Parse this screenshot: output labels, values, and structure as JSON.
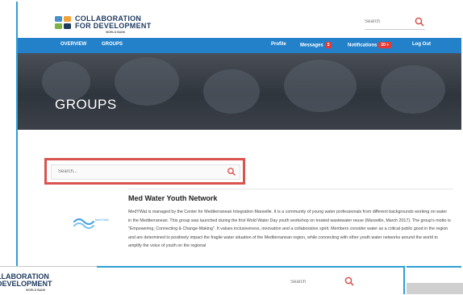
{
  "header": {
    "logo_line1": "COLLABORATION",
    "logo_line2": "FOR DEVELOPMENT",
    "logo_sub": "WORLD BANK",
    "search_placeholder": "Search"
  },
  "nav": {
    "overview": "OVERVIEW",
    "groups": "GROUPS",
    "profile": "Profile",
    "messages": "Messages",
    "messages_count": "5",
    "notifications": "Notifications",
    "notifications_count": "20 +",
    "logout": "Log Out"
  },
  "hero": {
    "title": "GROUPS"
  },
  "groups_search": {
    "placeholder": "Search..."
  },
  "group": {
    "title": "Med Water Youth Network",
    "logo_text": "MedYWat",
    "description": "MedYWat is managed by the Center for Mediterranean Integration Marseille. It is a community of young water professionals from different backgrounds working on water in the Mediterranean. This group was launched during the first Wold Water Day youth workshop on treated wastewater reuse (Marseille, March 2017). The group's motto is \"Empowering, Connecting & Change-Making\". It values inclusiveness, innovation and a collaborative spirit. Members consider water as a critical public good in the region and are determined to positively impact the fragile water situation of the Mediterranean region, while connecting with other youth water networks around the world to amplify the voice of youth on the regional"
  },
  "second_frame": {
    "logo_line1": "LLABORATION",
    "logo_line2": "DEVELOPMENT",
    "logo_sub": "WORLD BANK",
    "search_placeholder": "Search"
  },
  "colors": {
    "nav_bg": "#2381c9",
    "frame_border": "#2f9fd4",
    "highlight_border": "#d9534f",
    "badge": "#e53935",
    "brand_text": "#1e3a5f"
  }
}
